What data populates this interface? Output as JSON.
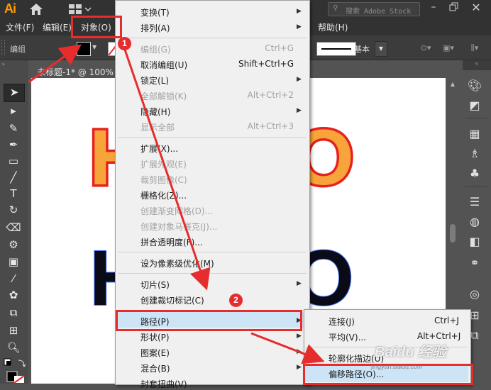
{
  "app": {
    "logo": "Ai",
    "search_placeholder": "搜索 Adobe Stock",
    "document_tab": "未标题-1* @ 100%"
  },
  "menubar": {
    "file": "文件(F)",
    "edit": "编辑(E)",
    "object": "对象(O)",
    "help": "帮助(H)"
  },
  "controlbar": {
    "selection_label": "编组",
    "stroke_style": "基本"
  },
  "object_menu": {
    "transform": "变换(T)",
    "arrange": "排列(A)",
    "group": "编组(G)",
    "group_shortcut": "Ctrl+G",
    "ungroup": "取消编组(U)",
    "ungroup_shortcut": "Shift+Ctrl+G",
    "lock": "锁定(L)",
    "unlock_all": "全部解锁(K)",
    "unlock_all_shortcut": "Alt+Ctrl+2",
    "hide": "隐藏(H)",
    "show_all": "显示全部",
    "show_all_shortcut": "Alt+Ctrl+3",
    "expand": "扩展(X)...",
    "expand_appearance": "扩展外观(E)",
    "crop_image": "裁剪图像(C)",
    "rasterize": "栅格化(Z)...",
    "create_gradient_mesh": "创建渐变网格(D)...",
    "create_object_mosaic": "创建对象马赛克(J)...",
    "flatten_transparency": "拼合透明度(F)...",
    "make_pixel_perfect": "设为像素级优化(M)",
    "slice": "切片(S)",
    "create_trim_marks": "创建裁切标记(C)",
    "path": "路径(P)",
    "shape": "形状(P)",
    "pattern": "图案(E)",
    "blend": "混合(B)",
    "envelope_distort": "封套扭曲(V)"
  },
  "path_submenu": {
    "join": "连接(J)",
    "join_shortcut": "Ctrl+J",
    "average": "平均(V)...",
    "average_shortcut": "Alt+Ctrl+J",
    "outline_stroke": "轮廓化描边(U)",
    "offset_path": "偏移路径(O)..."
  },
  "annotations": {
    "badge_1": "1",
    "badge_2": "2",
    "watermark": "Baidu 经验",
    "watermark_url": "jingyan.baidu.com"
  },
  "artwork": {
    "line1_text": "HELLO",
    "line2_text": "HELLO",
    "line1_fill": "#f7a43a",
    "line1_stroke": "#e8201e",
    "line2_fill": "#0b0b18",
    "selection_color": "#4e7bff"
  },
  "colors": {
    "highlight": "#cde4f7",
    "annotation_red": "#e52d2d",
    "ui_dark": "#323232",
    "ui_panel": "#535353"
  }
}
